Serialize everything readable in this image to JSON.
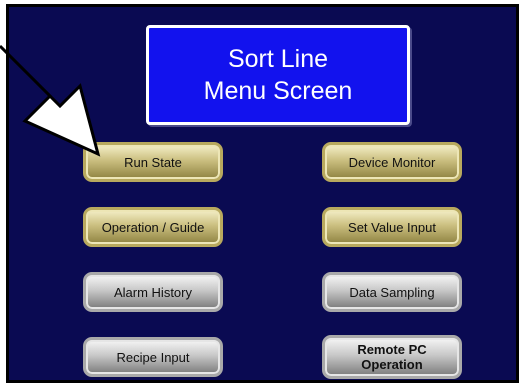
{
  "title": {
    "line1": "Sort Line",
    "line2": "Menu Screen"
  },
  "buttons": {
    "run_state": "Run State",
    "device_monitor": "Device Monitor",
    "operation_guide": "Operation / Guide",
    "set_value_input": "Set Value Input",
    "alarm_history": "Alarm History",
    "data_sampling": "Data Sampling",
    "recipe_input": "Recipe Input",
    "remote_pc_line1": "Remote PC",
    "remote_pc_line2": "Operation"
  },
  "annotation": {
    "icon": "pointer-arrow-icon",
    "color": "#ffffff"
  },
  "colors": {
    "screen_bg": "#0a0a52",
    "title_bg": "#1212ee",
    "gold_button": "#cbbf80",
    "silver_button": "#c8c8c8"
  }
}
